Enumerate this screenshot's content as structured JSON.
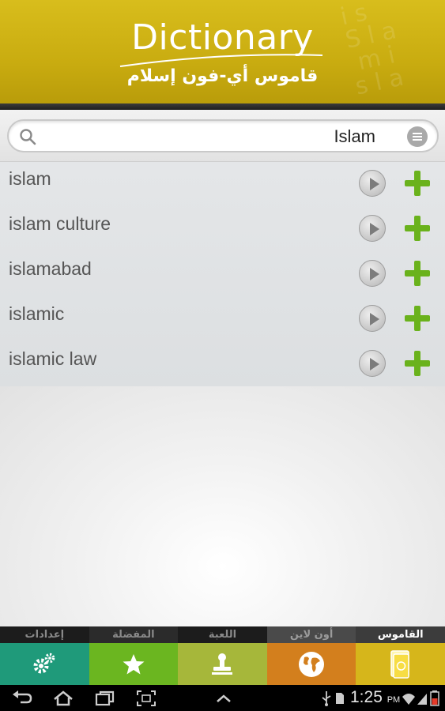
{
  "header": {
    "title": "Dictionary",
    "subtitle": "قاموس أي-فون إسلام",
    "brand_color": "#cdb214"
  },
  "search": {
    "value": "Islam",
    "placeholder": "",
    "left_icon": "search-icon",
    "right_icon": "menu-icon"
  },
  "results": [
    {
      "word": "islam",
      "play_icon": "play-icon",
      "add_icon": "plus-icon"
    },
    {
      "word": "islam culture",
      "play_icon": "play-icon",
      "add_icon": "plus-icon"
    },
    {
      "word": "islamabad",
      "play_icon": "play-icon",
      "add_icon": "plus-icon"
    },
    {
      "word": "islamic",
      "play_icon": "play-icon",
      "add_icon": "plus-icon"
    },
    {
      "word": "islamic law",
      "play_icon": "play-icon",
      "add_icon": "plus-icon"
    }
  ],
  "tabs": [
    {
      "label": "إعدادات",
      "icon": "gears-icon",
      "color": "#1f9a7a"
    },
    {
      "label": "المفضلة",
      "icon": "star-icon",
      "color": "#6bb620"
    },
    {
      "label": "اللعبة",
      "icon": "stamp-icon",
      "color": "#a6b73a"
    },
    {
      "label": "أون لاين",
      "icon": "globe-icon",
      "color": "#d37f1d"
    },
    {
      "label": "القاموس",
      "icon": "book-icon",
      "color": "#d6b61b",
      "active": true
    }
  ],
  "system_bar": {
    "time": "1:25",
    "ampm": "PM",
    "nav_icons": [
      "back-icon",
      "home-icon",
      "recent-apps-icon",
      "screenshot-icon",
      "up-chevron-icon"
    ],
    "status_icons": [
      "usb-icon",
      "sd-card-icon",
      "wifi-icon",
      "signal-icon",
      "battery-icon"
    ]
  }
}
